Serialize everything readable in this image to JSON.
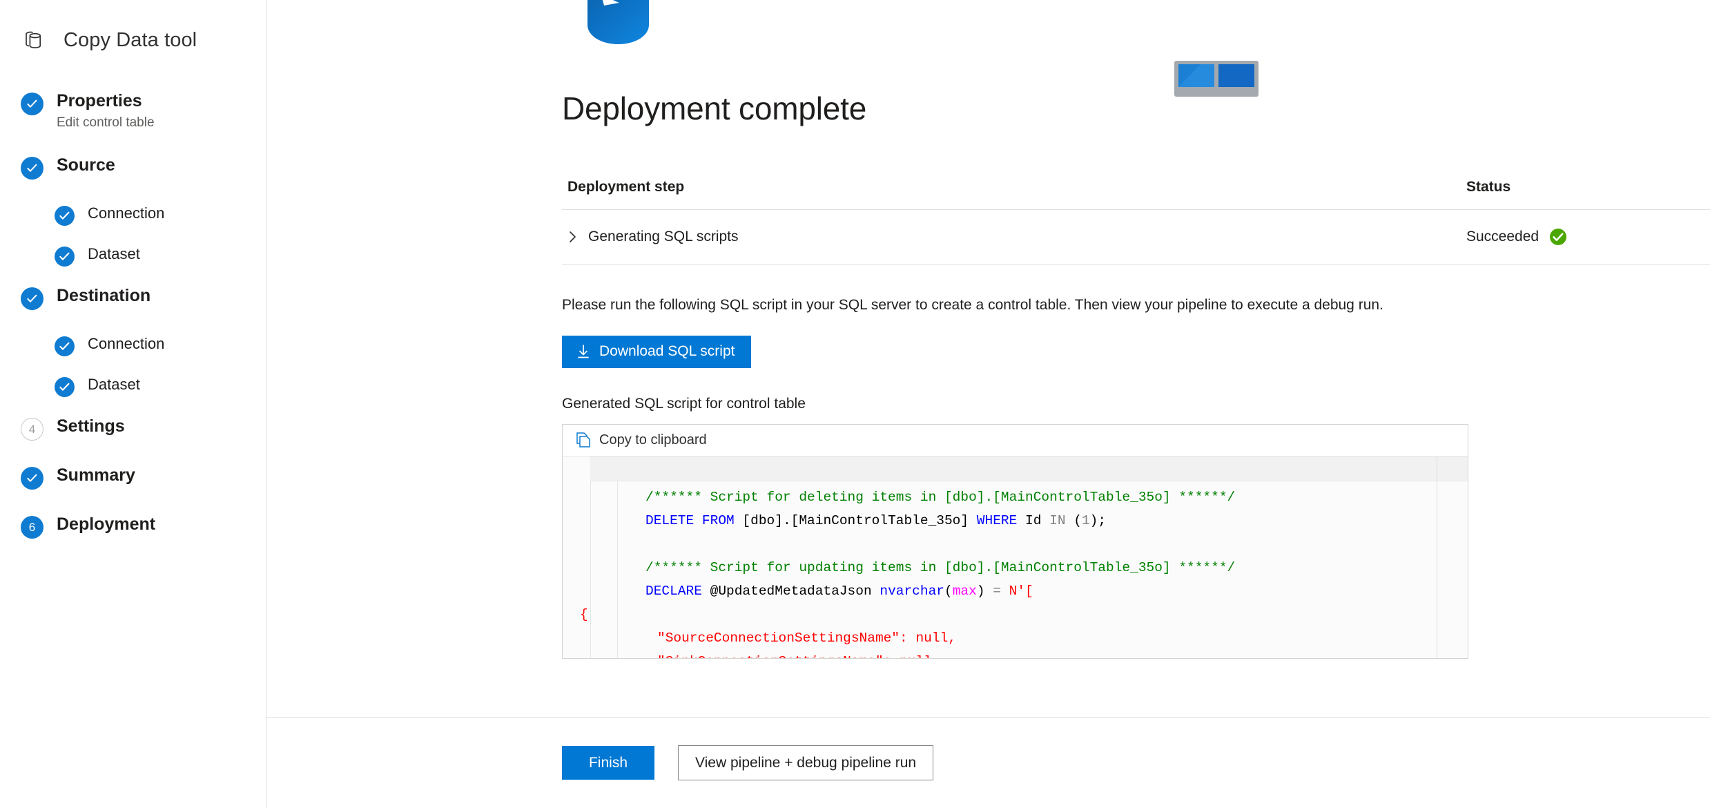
{
  "sidebar": {
    "brand_title": "Copy Data tool",
    "brand_icon": "database-stack-icon",
    "items": [
      {
        "label": "Properties",
        "sublabel": "Edit control table",
        "state": "done",
        "marker": "check"
      },
      {
        "label": "Source",
        "sublabel": "",
        "state": "done",
        "marker": "check"
      },
      {
        "label": "Connection",
        "sublabel": "",
        "state": "done",
        "marker": "check",
        "sub": true
      },
      {
        "label": "Dataset",
        "sublabel": "",
        "state": "done",
        "marker": "check",
        "sub": true
      },
      {
        "label": "Destination",
        "sublabel": "",
        "state": "done",
        "marker": "check"
      },
      {
        "label": "Connection",
        "sublabel": "",
        "state": "done",
        "marker": "check",
        "sub": true
      },
      {
        "label": "Dataset",
        "sublabel": "",
        "state": "done",
        "marker": "check",
        "sub": true
      },
      {
        "label": "Settings",
        "sublabel": "",
        "state": "todo",
        "marker": "4"
      },
      {
        "label": "Summary",
        "sublabel": "",
        "state": "done",
        "marker": "check"
      },
      {
        "label": "Deployment",
        "sublabel": "",
        "state": "current",
        "marker": "6"
      }
    ]
  },
  "window_controls": {
    "maximize_icon": "expand-diagonal-icon",
    "close_icon": "close-icon"
  },
  "main": {
    "page_title": "Deployment complete",
    "decor_icons": [
      "azure-sql-database-icon",
      "table-icon"
    ],
    "table": {
      "headers": [
        "Deployment step",
        "Status"
      ],
      "rows": [
        {
          "step": "Generating SQL scripts",
          "status": "Succeeded",
          "status_icon": "success-check-icon",
          "expander_icon": "chevron-right-icon"
        }
      ]
    },
    "instruction": "Please run the following SQL script in your SQL server to create a control table. Then view your pipeline to execute a debug run.",
    "download_button": {
      "label": "Download SQL script",
      "icon": "download-arrow-icon"
    },
    "generated_label": "Generated SQL script for control table",
    "editor": {
      "copy_label": "Copy to clipboard",
      "copy_icon": "copy-pages-icon",
      "lines": [
        {
          "indent": 2,
          "tokens": [
            {
              "t": "/****** Script for deleting items in [dbo].[MainControlTable_35o] ******/",
              "c": "cm"
            }
          ]
        },
        {
          "indent": 2,
          "tokens": [
            {
              "t": "DELETE FROM",
              "c": "kw"
            },
            {
              "t": " [dbo].[MainControlTable_35o] ",
              "c": "pl"
            },
            {
              "t": "WHERE",
              "c": "kw"
            },
            {
              "t": " Id ",
              "c": "pl"
            },
            {
              "t": "IN",
              "c": "gr"
            },
            {
              "t": " (",
              "c": "pl"
            },
            {
              "t": "1",
              "c": "gr"
            },
            {
              "t": ");",
              "c": "pl"
            }
          ]
        },
        {
          "indent": 2,
          "tokens": [
            {
              "t": "",
              "c": "pl"
            }
          ]
        },
        {
          "indent": 2,
          "tokens": [
            {
              "t": "/****** Script for updating items in [dbo].[MainControlTable_35o] ******/",
              "c": "cm"
            }
          ]
        },
        {
          "indent": 2,
          "tokens": [
            {
              "t": "DECLARE",
              "c": "kw"
            },
            {
              "t": " @UpdatedMetadataJson ",
              "c": "pl"
            },
            {
              "t": "nvarchar",
              "c": "ty"
            },
            {
              "t": "(",
              "c": "pl"
            },
            {
              "t": "max",
              "c": "mg"
            },
            {
              "t": ") ",
              "c": "pl"
            },
            {
              "t": "=",
              "c": "gr"
            },
            {
              "t": " ",
              "c": "pl"
            },
            {
              "t": "N'[",
              "c": "st"
            }
          ]
        },
        {
          "indent": 0,
          "tokens": [
            {
              "t": "{",
              "c": "st"
            }
          ]
        },
        {
          "indent": 1,
          "tokens": [
            {
              "t": "\"SourceConnectionSettingsName\": null,",
              "c": "st"
            }
          ]
        },
        {
          "indent": 1,
          "tokens": [
            {
              "t": "\"SinkConnectionSettingsName\": null,",
              "c": "st"
            }
          ]
        }
      ]
    }
  },
  "footer": {
    "finish_label": "Finish",
    "view_pipeline_label": "View pipeline + debug pipeline run"
  },
  "colors": {
    "accent": "#0078d4",
    "step_blue": "#0f7bd1",
    "success_green": "#4ba700",
    "scrollbar_thumb": "#3b4654"
  }
}
